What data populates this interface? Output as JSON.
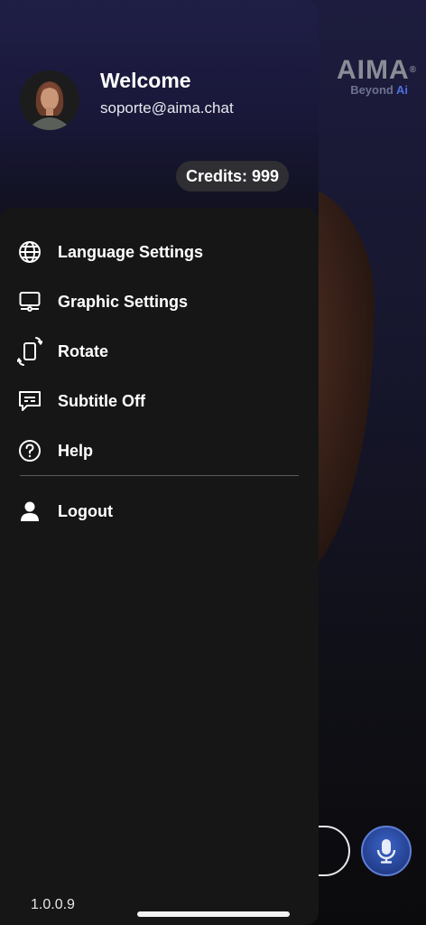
{
  "background": {
    "brand_name": "AIMA",
    "brand_mark": "®",
    "brand_tagline_prefix": "Beyond ",
    "brand_tagline_ai": "Ai",
    "accent_color": "#3a64c8"
  },
  "drawer": {
    "welcome": "Welcome",
    "email": "soporte@aima.chat",
    "credits": "Credits: 999",
    "items": [
      {
        "label": "Language Settings",
        "icon": "globe-icon"
      },
      {
        "label": "Graphic Settings",
        "icon": "monitor-icon"
      },
      {
        "label": "Rotate",
        "icon": "rotate-phone-icon"
      },
      {
        "label": "Subtitle Off",
        "icon": "subtitles-icon"
      },
      {
        "label": "Help",
        "icon": "help-icon"
      }
    ],
    "logout": {
      "label": "Logout",
      "icon": "user-icon"
    },
    "version": "1.0.0.9"
  }
}
